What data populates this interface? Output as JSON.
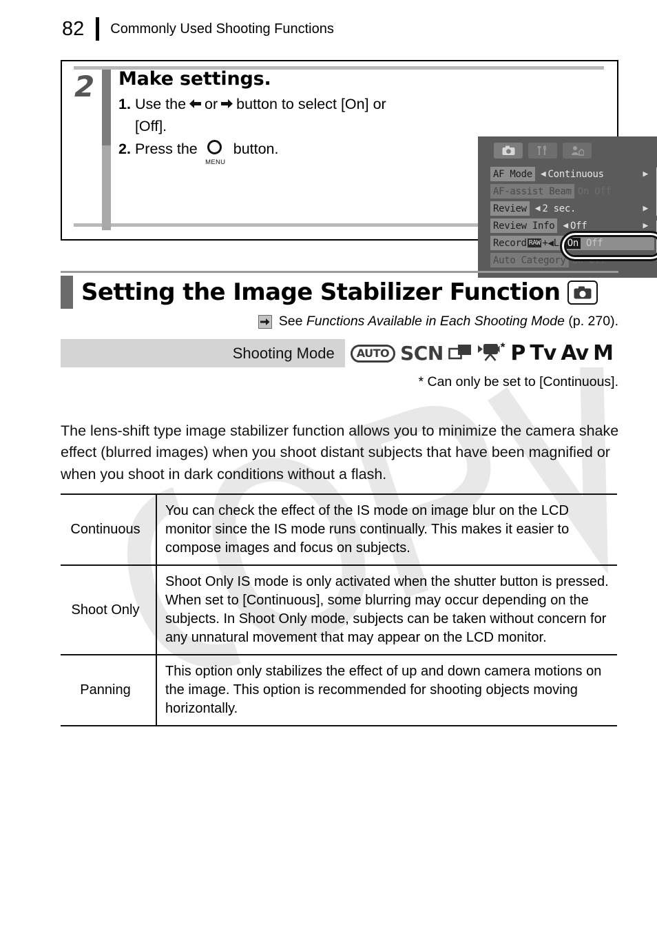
{
  "header": {
    "page_number": "82",
    "title": "Commonly Used Shooting Functions"
  },
  "step_box": {
    "step_number": "2",
    "title": "Make settings.",
    "items": [
      {
        "marker": "1.",
        "text_before": "Use the",
        "icon_left": "left-arrow-icon",
        "text_middle": "or",
        "icon_right": "right-arrow-icon",
        "text_after": "button to select [On] or [Off]."
      },
      {
        "marker": "2.",
        "text_before": "Press the",
        "icon": "menu-button-icon",
        "icon_label": "MENU",
        "text_after": "button."
      }
    ]
  },
  "lcd": {
    "tabs": [
      {
        "name": "shooting-tab",
        "icon": "camera-icon",
        "active": true
      },
      {
        "name": "setup-tab",
        "icon": "tools-icon",
        "active": false
      },
      {
        "name": "my-camera-tab",
        "icon": "my-camera-icon",
        "active": false
      }
    ],
    "rows": [
      {
        "label": "AF Mode",
        "value": "Continuous",
        "type": "spinner",
        "dim": false
      },
      {
        "label": "AF-assist Beam",
        "options": [
          "On",
          "Off"
        ],
        "selected": "On",
        "type": "toggle",
        "dim": true
      },
      {
        "label": "Review",
        "value": "2 sec.",
        "type": "spinner",
        "dim": false
      },
      {
        "label": "Review Info",
        "value": "Off",
        "type": "spinner",
        "dim": false
      },
      {
        "label": "Record",
        "label_suffix": "RAW+L",
        "options": [
          "On",
          "Off"
        ],
        "selected": "On",
        "type": "toggle",
        "dim": false,
        "highlighted": true
      },
      {
        "label": "Auto Category",
        "options": [
          "On",
          "Off"
        ],
        "selected": "On",
        "type": "toggle",
        "dim": true
      }
    ]
  },
  "section": {
    "title": "Setting the Image Stabilizer Function",
    "title_icon": "camera-icon",
    "see_arrow_icon": "arrow-right-icon",
    "see_prefix": "See",
    "see_italic": "Functions Available in Each Shooting Mode",
    "see_suffix": "(p. 270)."
  },
  "shooting_mode": {
    "label": "Shooting Mode",
    "modes": [
      {
        "name": "auto-mode-icon",
        "label": "AUTO",
        "style": "auto"
      },
      {
        "name": "scn-mode-icon",
        "label": "SCN",
        "style": "scn"
      },
      {
        "name": "stitch-assist-mode-icon",
        "label": "",
        "style": "stitch"
      },
      {
        "name": "movie-mode-icon",
        "label": "",
        "style": "movie",
        "asterisk": "*"
      },
      {
        "name": "p-mode-icon",
        "label": "P",
        "style": "letter"
      },
      {
        "name": "tv-mode-icon",
        "label": "Tv",
        "style": "letter"
      },
      {
        "name": "av-mode-icon",
        "label": "Av",
        "style": "letter"
      },
      {
        "name": "m-mode-icon",
        "label": "M",
        "style": "letter"
      }
    ],
    "note": "* Can only be set to [Continuous]."
  },
  "body_paragraph": "The lens-shift type image stabilizer function allows you to minimize the camera shake effect (blurred images) when you shoot distant subjects that have been magnified or when you shoot in dark conditions without a flash.",
  "table": {
    "rows": [
      {
        "mode": "Continuous",
        "description": "You can check the effect of the IS mode on image blur on the LCD monitor since the IS mode runs continually. This makes it easier to compose images and focus on subjects."
      },
      {
        "mode": "Shoot Only",
        "description": "Shoot Only IS mode is only activated when the shutter button is pressed. When set to [Continuous], some blurring may occur depending on the subjects. In Shoot Only mode, subjects can be taken without concern for any unnatural movement that may appear on the LCD monitor."
      },
      {
        "mode": "Panning",
        "description": "This option only stabilizes the effect of up and down camera motions on the image. This option is recommended for shooting objects moving horizontally."
      }
    ]
  },
  "colors": {
    "accent_gray": "#6b6b6b",
    "mode_bar_bg": "#d4d4d4",
    "lcd_bg": "#5b5b5b",
    "rule_gray": "#b8b8b8"
  }
}
